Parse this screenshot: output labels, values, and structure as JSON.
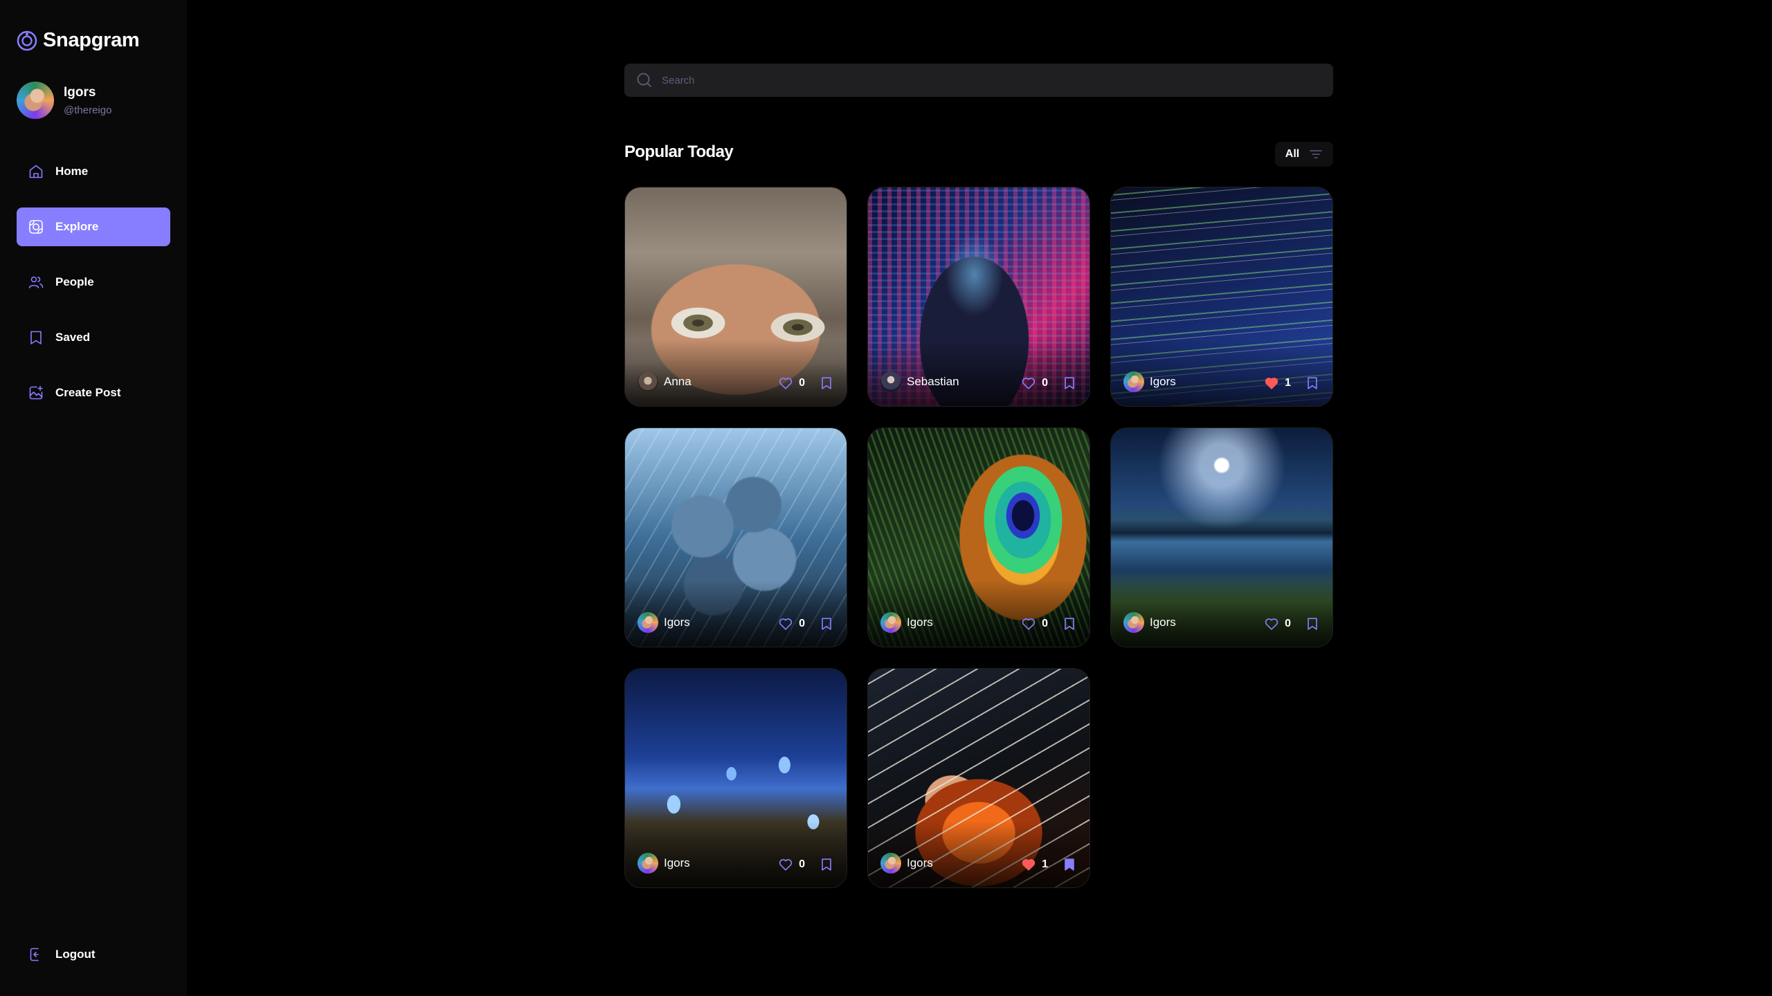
{
  "app": {
    "name": "Snapgram"
  },
  "user": {
    "name": "Igors",
    "handle": "@thereigo"
  },
  "nav": {
    "items": [
      {
        "label": "Home",
        "icon": "home-icon"
      },
      {
        "label": "Explore",
        "icon": "explore-icon",
        "active": true
      },
      {
        "label": "People",
        "icon": "people-icon"
      },
      {
        "label": "Saved",
        "icon": "bookmark-icon"
      },
      {
        "label": "Create Post",
        "icon": "create-post-icon"
      }
    ],
    "logout": "Logout"
  },
  "search": {
    "placeholder": "Search",
    "value": ""
  },
  "section": {
    "title": "Popular Today",
    "filter_label": "All"
  },
  "posts": [
    {
      "author": "Anna",
      "likes": "0",
      "liked": false,
      "saved": false
    },
    {
      "author": "Sebastian",
      "likes": "0",
      "liked": false,
      "saved": false
    },
    {
      "author": "Igors",
      "likes": "1",
      "liked": true,
      "saved": false
    },
    {
      "author": "Igors",
      "likes": "0",
      "liked": false,
      "saved": false
    },
    {
      "author": "Igors",
      "likes": "0",
      "liked": false,
      "saved": false
    },
    {
      "author": "Igors",
      "likes": "0",
      "liked": false,
      "saved": false
    },
    {
      "author": "Igors",
      "likes": "0",
      "liked": false,
      "saved": false
    },
    {
      "author": "Igors",
      "likes": "1",
      "liked": true,
      "saved": true
    }
  ],
  "colors": {
    "accent": "#877eff",
    "like": "#ff5a5a",
    "background": "#000000",
    "sidebar": "#09090a"
  }
}
